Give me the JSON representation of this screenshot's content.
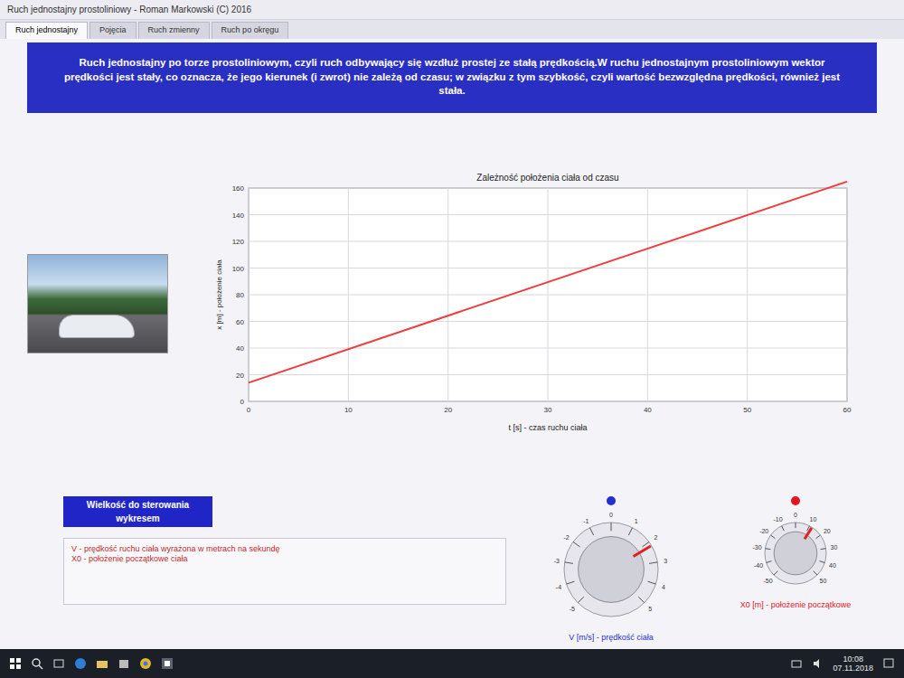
{
  "window": {
    "title": "Ruch jednostajny prostoliniowy - Roman Markowski (C) 2016"
  },
  "tabs": [
    {
      "label": "Ruch jednostajny",
      "selected": true
    },
    {
      "label": "Pojęcia",
      "selected": false
    },
    {
      "label": "Ruch zmienny",
      "selected": false
    },
    {
      "label": "Ruch po okręgu",
      "selected": false
    }
  ],
  "description": "Ruch jednostajny po torze prostoliniowym, czyli ruch odbywający się wzdłuż prostej ze stałą prędkością.W ruchu jednostajnym prostoliniowym wektor prędkości jest stały, co oznacza, że jego kierunek (i zwrot) nie zależą od czasu; w związku z tym szybkość, czyli wartość bezwzględna prędkości, również jest stała.",
  "chart": {
    "title": "Zależność położenia ciała od czasu",
    "y_label": "x [m] - położenie ciała",
    "x_label": "t [s] - czas ruchu ciała",
    "y_ticks": [
      "0",
      "20",
      "40",
      "60",
      "80",
      "100",
      "120",
      "140",
      "160"
    ],
    "x_ticks": [
      "0",
      "10",
      "20",
      "30",
      "40",
      "50",
      "60"
    ],
    "series": [
      {
        "t": [
          0,
          60
        ],
        "x": [
          14,
          165
        ]
      }
    ]
  },
  "controls": {
    "title": "Wielkość do sterowania wykresem",
    "notes": [
      "V - prędkość ruchu ciała wyrażona w metrach na sekundę",
      "X0 - położenie początkowe ciała"
    ],
    "dials": [
      {
        "label": "V [m/s] - prędkość ciała",
        "color": "#1f2fd0",
        "level": 0.72,
        "ticks": [
          "-5",
          "-4",
          "-3",
          "-2",
          "-1",
          "0",
          "1",
          "2",
          "3",
          "4",
          "5"
        ]
      },
      {
        "label": "X0 [m] - położenie początkowe",
        "color": "#e0181e",
        "level": 0.62,
        "ticks": [
          "-50",
          "-40",
          "-30",
          "-20",
          "-10",
          "0",
          "10",
          "20",
          "30",
          "40",
          "50"
        ]
      }
    ]
  },
  "taskbar": {
    "time": "10:08",
    "date": "07.11.2018"
  }
}
